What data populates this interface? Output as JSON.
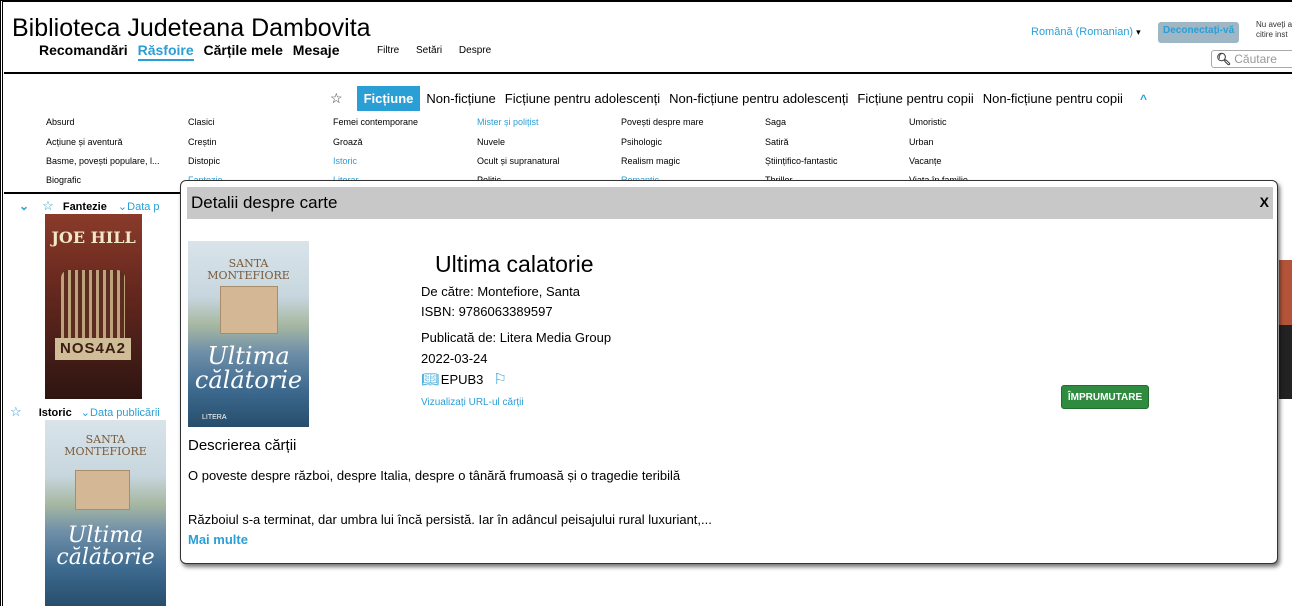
{
  "header": {
    "library_name": "Biblioteca Judeteana Dambovita",
    "main_nav": [
      "Recomandări",
      "Răsfoire",
      "Cărțile mele",
      "Mesaje"
    ],
    "sub_nav": [
      "Filtre",
      "Setări",
      "Despre"
    ],
    "language": "Română (Romanian)",
    "logout_label": "Deconectați-vă",
    "no_user_text_1": "Nu aveți a",
    "no_user_text_2": "citire inst",
    "search_placeholder": "Căutare"
  },
  "genre_tabs": [
    "Ficțiune",
    "Non-ficțiune",
    "Ficțiune pentru adolescenți",
    "Non-ficțiune pentru adolescenți",
    "Ficțiune pentru copii",
    "Non-ficțiune pentru copii"
  ],
  "sub_genres": {
    "col1": [
      "Absurd",
      "Acțiune și aventură",
      "Basme, povești populare, l...",
      "Biografic"
    ],
    "col2": [
      "Clasici",
      "Creștin",
      "Distopic",
      "Fantezie"
    ],
    "col3": [
      "Femei contemporane",
      "Groază",
      "Istoric",
      "Literar"
    ],
    "col4": [
      "Mister și polițist",
      "Nuvele",
      "Ocult și supranatural",
      "Politic"
    ],
    "col5": [
      "Povești despre mare",
      "Psihologic",
      "Realism magic",
      "Romantic"
    ],
    "col6": [
      "Saga",
      "Satiră",
      "Științifico-fantastic",
      "Thriller"
    ],
    "col7": [
      "Umoristic",
      "Urban",
      "Vacanțe",
      "Viața în familie"
    ]
  },
  "sections": [
    {
      "label": "Fantezie",
      "sort": "Data p"
    },
    {
      "label": "Istoric",
      "sort": "Data publicării"
    }
  ],
  "covers": {
    "joe_hill": {
      "author": "JOE HILL",
      "title": "NOS4A2"
    },
    "ultima": {
      "author_line1": "SANTA",
      "author_line2": "MONTEFIORE",
      "title_line1": "Ultima",
      "title_line2": "călătorie",
      "publisher": "LITERA"
    }
  },
  "modal": {
    "heading": "Detalii despre carte",
    "close": "X",
    "title": "Ultima calatorie",
    "author": "De către: Montefiore, Santa",
    "isbn": "ISBN: 9786063389597",
    "publisher": "Publicată de: Litera Media Group",
    "date": "2022-03-24",
    "format": "EPUB3",
    "view_url": "Vizualizați URL-ul cărții",
    "borrow": "ÎMPRUMUTARE",
    "desc_heading": "Descrierea cărții",
    "desc_line1": "O poveste despre război, despre Italia, despre o tânără frumoasă și o tragedie teribilă",
    "desc_line2": "Războiul s-a terminat, dar umbra lui încă persistă. Iar în adâncul peisajului rural luxuriant,...",
    "more": "Mai multe"
  },
  "colors": {
    "accent": "#2a9fd6",
    "borrow": "#2e8b3f",
    "modal_header": "#c8c8c8"
  }
}
